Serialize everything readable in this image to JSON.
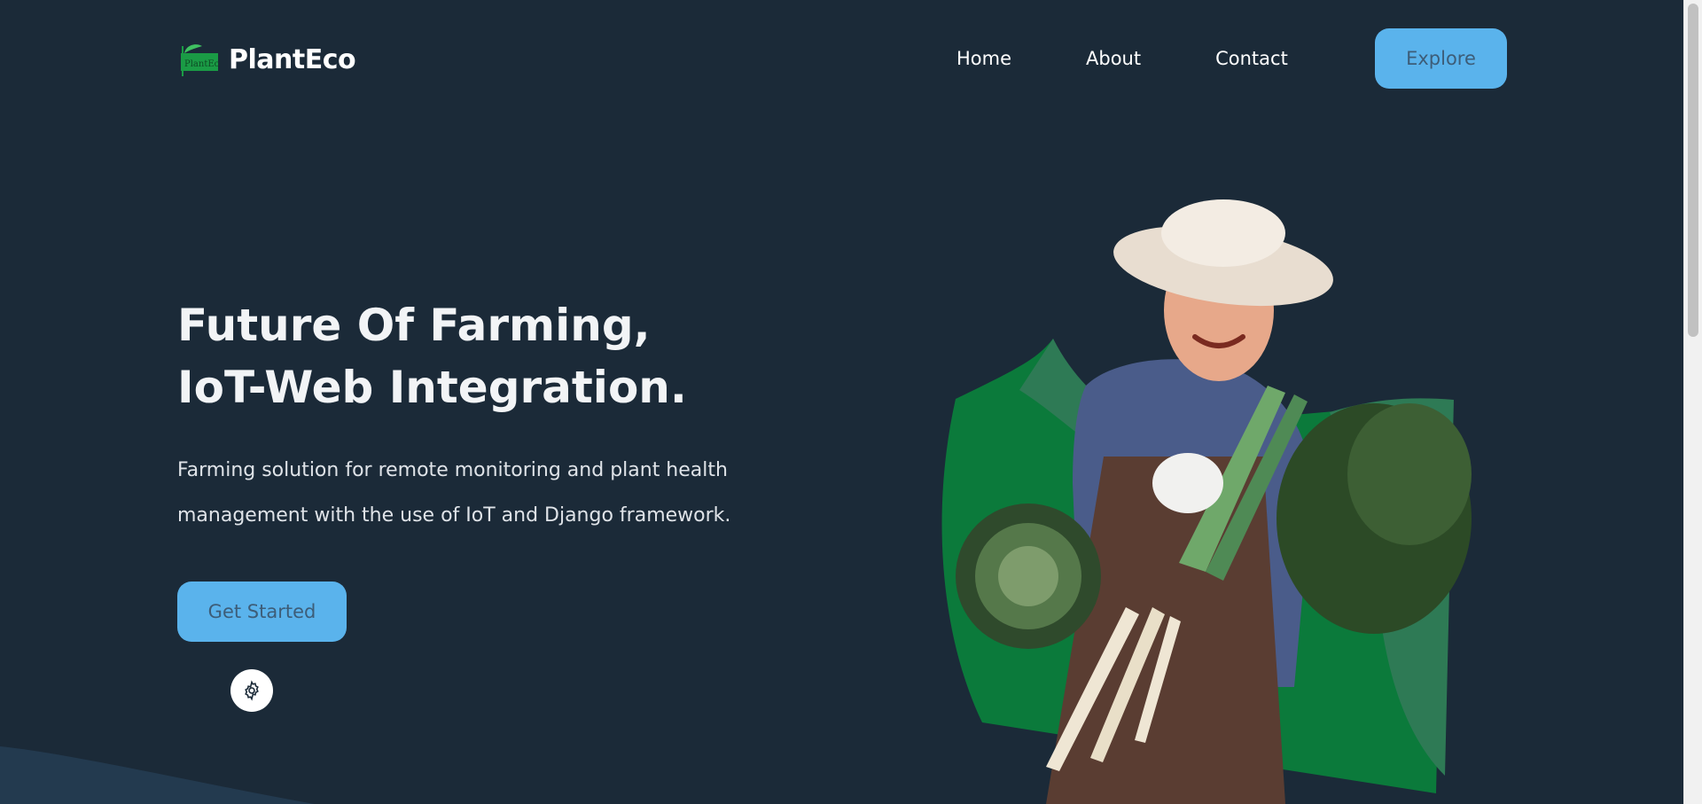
{
  "brand": {
    "name": "PlantEco",
    "logo_text": "PlantEco",
    "logo_icon": "leaf-icon"
  },
  "nav": {
    "items": [
      {
        "label": "Home"
      },
      {
        "label": "About"
      },
      {
        "label": "Contact"
      }
    ],
    "explore_label": "Explore"
  },
  "hero": {
    "title_line1": "Future Of Farming,",
    "title_line2": "IoT-Web Integration.",
    "description_line1": "Farming solution for remote monitoring and plant health",
    "description_line2": "management with the use of IoT and Django framework.",
    "cta_label": "Get Started",
    "image": "farmer-holding-vegetables-illustration"
  },
  "settings": {
    "icon": "gear-icon"
  },
  "colors": {
    "background": "#1b2a38",
    "accent": "#5ab3ec",
    "button_text": "#3d5d78",
    "green_dark": "#0b7a3b",
    "green_light": "#2e7a55"
  }
}
